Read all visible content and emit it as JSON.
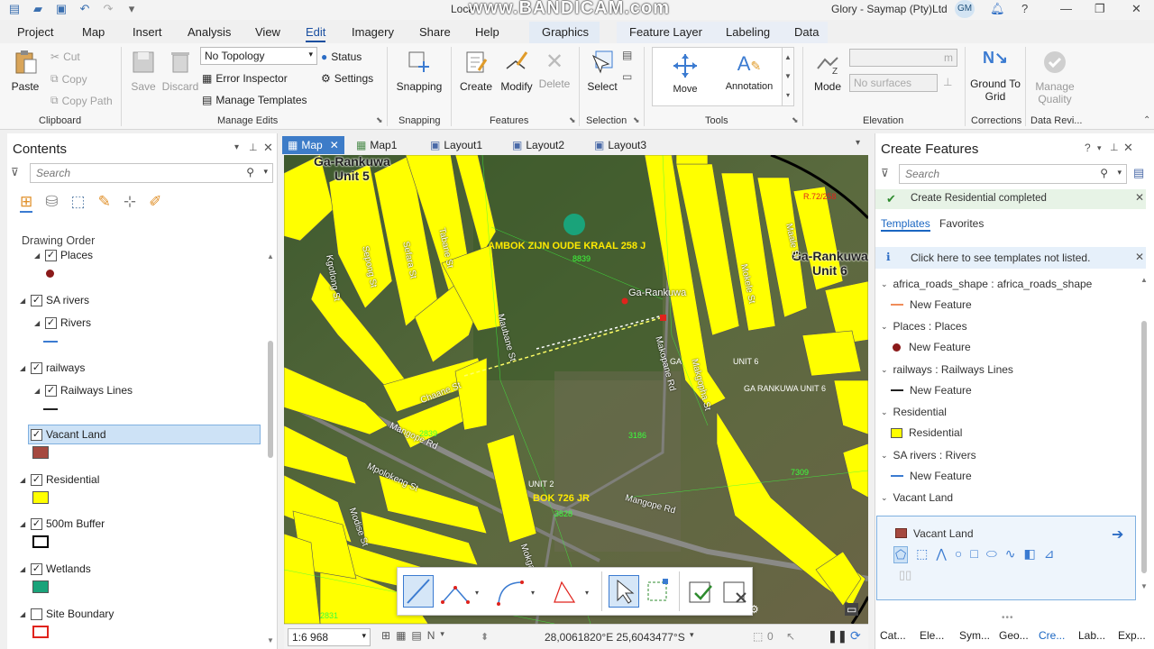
{
  "titlebar": {
    "document": "Loca",
    "watermark": "www.BANDICAM.com",
    "user": "Glory - Saymap (Pty)Ltd",
    "avatar": "GM"
  },
  "tabs": [
    "Project",
    "Map",
    "Insert",
    "Analysis",
    "View",
    "Edit",
    "Imagery",
    "Share",
    "Help",
    "Graphics",
    "Feature Layer",
    "Labeling",
    "Data"
  ],
  "ribbon": {
    "clipboard": {
      "paste": "Paste",
      "cut": "Cut",
      "copy": "Copy",
      "copy_path": "Copy Path",
      "label": "Clipboard"
    },
    "manage_edits": {
      "save": "Save",
      "discard": "Discard",
      "topology": "No Topology",
      "error_inspector": "Error Inspector",
      "manage_templates": "Manage Templates",
      "status": "Status",
      "settings": "Settings",
      "label": "Manage Edits"
    },
    "snapping": {
      "snapping": "Snapping",
      "label": "Snapping"
    },
    "features": {
      "create": "Create",
      "modify": "Modify",
      "delete": "Delete",
      "label": "Features"
    },
    "selection": {
      "select": "Select",
      "label": "Selection"
    },
    "tools": {
      "move": "Move",
      "annotation": "Annotation",
      "label": "Tools"
    },
    "elevation": {
      "mode": "Mode",
      "surfaces": "No surfaces",
      "unit": "m",
      "label": "Elevation"
    },
    "corrections": {
      "ground_to_grid": "Ground To Grid",
      "label": "Corrections"
    },
    "data_review": {
      "manage_quality": "Manage Quality",
      "label": "Data Revi..."
    }
  },
  "contents": {
    "title": "Contents",
    "search_placeholder": "Search",
    "drawing_order": "Drawing Order",
    "layers": [
      {
        "name": "Places",
        "checked": true,
        "sub": true,
        "swatch": "#8b1a1a",
        "swatch_type": "dot"
      },
      {
        "name": "SA rivers",
        "checked": true,
        "sub": false
      },
      {
        "name": "Rivers",
        "checked": true,
        "sub": true,
        "swatch": "#3b7bd1",
        "swatch_type": "line"
      },
      {
        "name": "railways",
        "checked": true,
        "sub": false
      },
      {
        "name": "Railways Lines",
        "checked": true,
        "sub": true,
        "swatch": "#222222",
        "swatch_type": "line"
      },
      {
        "name": "Vacant Land",
        "checked": true,
        "sub": false,
        "swatch": "#a5493f",
        "swatch_type": "fill",
        "selected": true
      },
      {
        "name": "Residential",
        "checked": true,
        "sub": false,
        "swatch": "#ffff00",
        "swatch_type": "fill"
      },
      {
        "name": "500m Buffer",
        "checked": true,
        "sub": false,
        "swatch": "#000000",
        "swatch_type": "outline"
      },
      {
        "name": "Wetlands",
        "checked": true,
        "sub": false,
        "swatch": "#1aa37a",
        "swatch_type": "fill"
      },
      {
        "name": "Site Boundary",
        "checked": false,
        "sub": false,
        "swatch": "#e0231c",
        "swatch_type": "outline"
      }
    ]
  },
  "view_tabs": [
    "Map",
    "Map1",
    "Layout1",
    "Layout2",
    "Layout3"
  ],
  "map": {
    "labels": {
      "unit5": "Ga-Rankuwa\nUnit 5",
      "unit6": "Ga-Rankuwa\nUnit 6",
      "kraal": "AMBOK ZIJN OUDE KRAAL 258 J",
      "kraal_no": "8839",
      "garankuwa": "Ga-Rankuwa",
      "bok726": "BOK 726 JR",
      "unit2": "UNIT 2",
      "unit6b": "UNIT 6",
      "garankuwa_unit6": "GA RANKUWA UNIT 6",
      "ga": "GA",
      "r72": "R.72/258",
      "n3186": "3186",
      "n3828": "3828",
      "n7309": "7309",
      "n2839": "2839",
      "n2831": "2831"
    },
    "streets": [
      "Kgotlong St",
      "Sepong St",
      "Sefara St",
      "Tabane St",
      "Maubane St",
      "Chaane St",
      "Mangope Rd",
      "Mpolokeng St",
      "Modise St",
      "Mokgatle St",
      "Makopane Rd",
      "Makgopha St",
      "Mokele St",
      "Maale St",
      "Mangope Rd"
    ]
  },
  "statusbar": {
    "scale": "1:6 968",
    "coords": "28,0061820°E 25,6043477°S",
    "selected": "0"
  },
  "create_features": {
    "title": "Create Features",
    "search_placeholder": "Search",
    "completed": "Create Residential completed",
    "tab_templates": "Templates",
    "tab_favorites": "Favorites",
    "info": "Click here to see templates not listed.",
    "groups": [
      {
        "header": "africa_roads_shape : africa_roads_shape",
        "item": "New Feature",
        "swatch": "#f08c5a",
        "type": "line"
      },
      {
        "header": "Places : Places",
        "item": "New Feature",
        "swatch": "#8b1a1a",
        "type": "dot"
      },
      {
        "header": "railways : Railways Lines",
        "item": "New Feature",
        "swatch": "#222222",
        "type": "line"
      },
      {
        "header": "Residential",
        "item": "Residential",
        "swatch": "#ffff00",
        "type": "fill"
      },
      {
        "header": "SA rivers : Rivers",
        "item": "New Feature",
        "swatch": "#3b7bd1",
        "type": "line"
      },
      {
        "header": "Vacant Land",
        "item": "",
        "swatch": "",
        "type": ""
      }
    ],
    "active_template": "Vacant Land",
    "active_swatch": "#a5493f",
    "bottom_tabs": [
      "Cat...",
      "Ele...",
      "Sym...",
      "Geo...",
      "Cre...",
      "Lab...",
      "Exp..."
    ]
  }
}
